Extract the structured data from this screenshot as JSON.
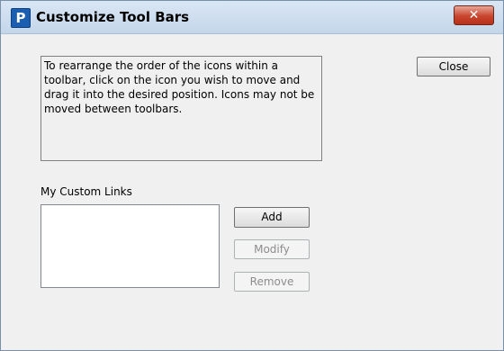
{
  "window": {
    "title": "Customize Tool Bars",
    "app_icon_letter": "P",
    "close_glyph": "✕"
  },
  "instructions": "To rearrange the order of the icons within a toolbar, click on the icon you wish to move and drag it into the desired position. Icons may not be moved between toolbars.",
  "buttons": {
    "close": "Close",
    "add": "Add",
    "modify": "Modify",
    "remove": "Remove"
  },
  "custom_links": {
    "label": "My Custom Links",
    "items": []
  },
  "colors": {
    "title_close_button": "#c8452e",
    "app_icon": "#1b5fb0"
  }
}
